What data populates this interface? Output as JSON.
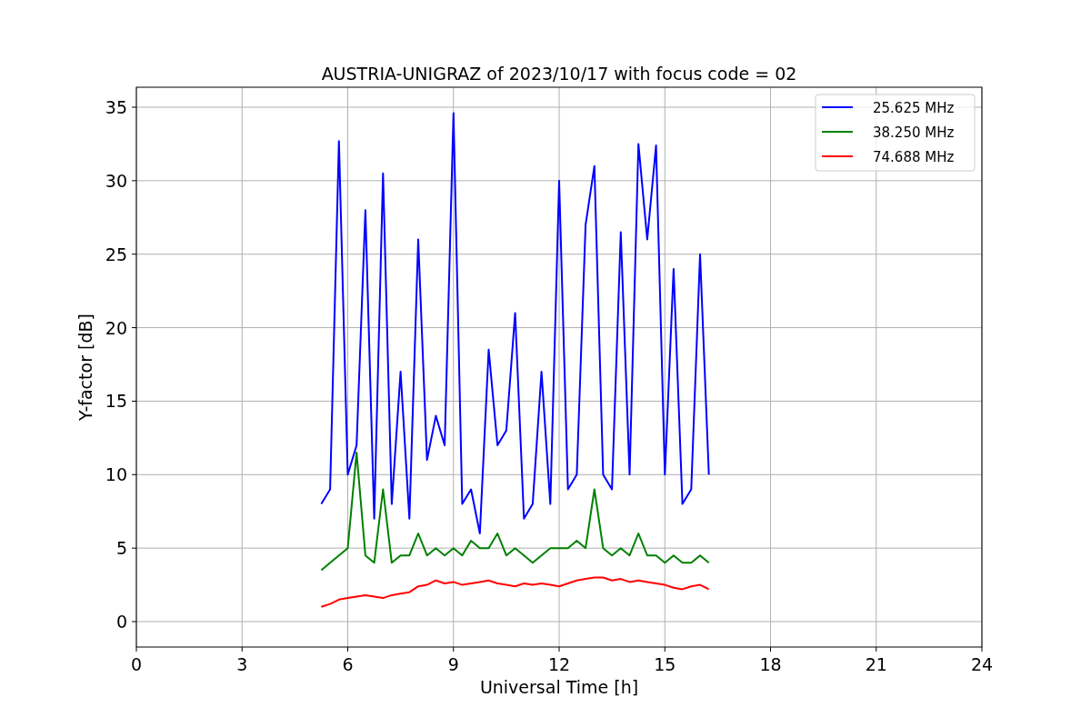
{
  "figure": {
    "chart_data": {
      "type": "line",
      "title": "AUSTRIA-UNIGRAZ of 2023/10/17 with focus code = 02",
      "xlabel": "Universal Time [h]",
      "ylabel": "Y-factor [dB]",
      "x": [
        5.25,
        5.5,
        5.75,
        6,
        6.25,
        6.5,
        6.75,
        7,
        7.25,
        7.5,
        7.75,
        8,
        8.25,
        8.5,
        8.75,
        9,
        9.25,
        9.5,
        9.75,
        10,
        10.25,
        10.5,
        10.75,
        11,
        11.25,
        11.5,
        11.75,
        12,
        12.25,
        12.5,
        12.75,
        13,
        13.25,
        13.5,
        13.75,
        14,
        14.25,
        14.5,
        14.75,
        15,
        15.25,
        15.5,
        15.75,
        16,
        16.25
      ],
      "series": [
        {
          "name": "25.625 MHz",
          "color": "#0000ff",
          "values": [
            8,
            9,
            32.7,
            10,
            12,
            28,
            7,
            30.5,
            8,
            17,
            7,
            26,
            11,
            14,
            12,
            34.6,
            8,
            9,
            6,
            18.5,
            12,
            13,
            21,
            7,
            8,
            17,
            8,
            30,
            9,
            10,
            27,
            31,
            10,
            9,
            26.5,
            10,
            32.5,
            26,
            32.4,
            10,
            24,
            8,
            9,
            25,
            10
          ]
        },
        {
          "name": "38.250 MHz",
          "color": "#008000",
          "values": [
            3.5,
            4,
            4.5,
            5,
            11.5,
            4.5,
            4,
            9,
            4,
            4.5,
            4.5,
            6,
            4.5,
            5,
            4.5,
            5,
            4.5,
            5.5,
            5,
            5,
            6,
            4.5,
            5,
            4.5,
            4,
            4.5,
            5,
            5,
            5,
            5.5,
            5,
            9,
            5,
            4.5,
            5,
            4.5,
            6,
            4.5,
            4.5,
            4,
            4.5,
            4,
            4,
            4.5,
            4
          ]
        },
        {
          "name": "74.688 MHz",
          "color": "#ff0000",
          "values": [
            1,
            1.2,
            1.5,
            1.6,
            1.7,
            1.8,
            1.7,
            1.6,
            1.8,
            1.9,
            2,
            2.4,
            2.5,
            2.8,
            2.6,
            2.7,
            2.5,
            2.6,
            2.7,
            2.8,
            2.6,
            2.5,
            2.4,
            2.6,
            2.5,
            2.6,
            2.5,
            2.4,
            2.6,
            2.8,
            2.9,
            3,
            3,
            2.8,
            2.9,
            2.7,
            2.8,
            2.7,
            2.6,
            2.5,
            2.3,
            2.2,
            2.4,
            2.5,
            2.2
          ]
        }
      ],
      "xlim": [
        0,
        24
      ],
      "ylim": [
        -1.73,
        36.36
      ],
      "xticks": [
        0,
        3,
        6,
        9,
        12,
        15,
        18,
        21,
        24
      ],
      "yticks": [
        0,
        5,
        10,
        15,
        20,
        25,
        30,
        35
      ],
      "grid": true,
      "legend": true
    }
  }
}
